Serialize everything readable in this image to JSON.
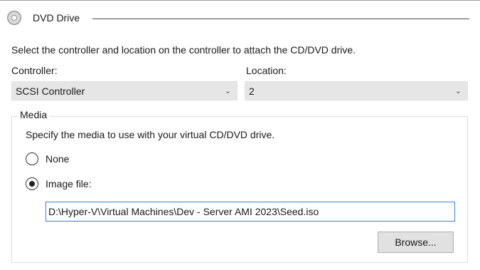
{
  "section": {
    "title": "DVD Drive",
    "icon": "disc-icon"
  },
  "instructions": "Select the controller and location on the controller to attach the CD/DVD drive.",
  "controller": {
    "label": "Controller:",
    "value": "SCSI Controller"
  },
  "location": {
    "label": "Location:",
    "value": "2"
  },
  "media": {
    "legend": "Media",
    "description": "Specify the media to use with your virtual CD/DVD drive.",
    "none_label": "None",
    "image_label": "Image file:",
    "selected": "image",
    "path": "D:\\Hyper-V\\Virtual Machines\\Dev - Server AMI 2023\\Seed.iso",
    "browse_label": "Browse..."
  }
}
